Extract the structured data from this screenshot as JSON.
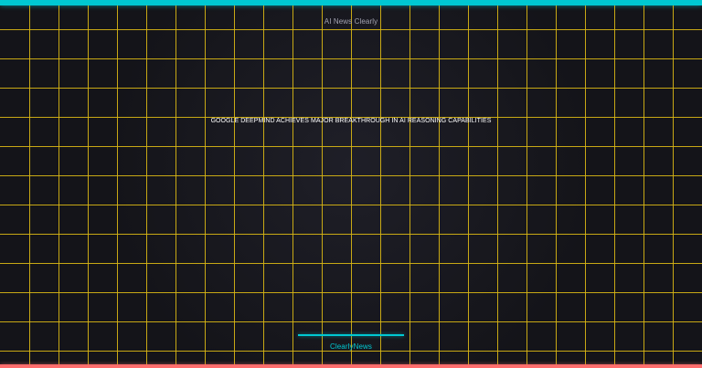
{
  "branding": {
    "top_label": "AI News Clearly",
    "footer_label": "ClearlyNews"
  },
  "story": {
    "headline": "GOOGLE DEEPMIND ACHIEVES MAJOR BREAKTHROUGH IN AI REASONING CAPABILITIES"
  },
  "colors": {
    "background": "#141419",
    "grid": "#d7b515",
    "accent_cyan": "#00c8d2",
    "accent_coral": "#ff6d6d",
    "headline_text": "#ffffff",
    "top_label_text": "#a3a3b1"
  }
}
